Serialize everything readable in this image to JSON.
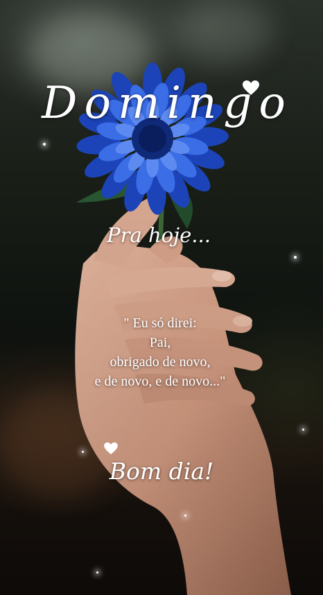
{
  "title": "Domingo",
  "subtitle": "Pra hoje...",
  "quote_lines": [
    "\" Eu só direi:",
    "Pai,",
    "obrigado de novo,",
    "e de novo, e de novo...\""
  ],
  "greeting": "Bom dia!",
  "colors": {
    "petal": "#2f5fd8",
    "petal_dark": "#173a9e",
    "text": "#ffffff"
  }
}
